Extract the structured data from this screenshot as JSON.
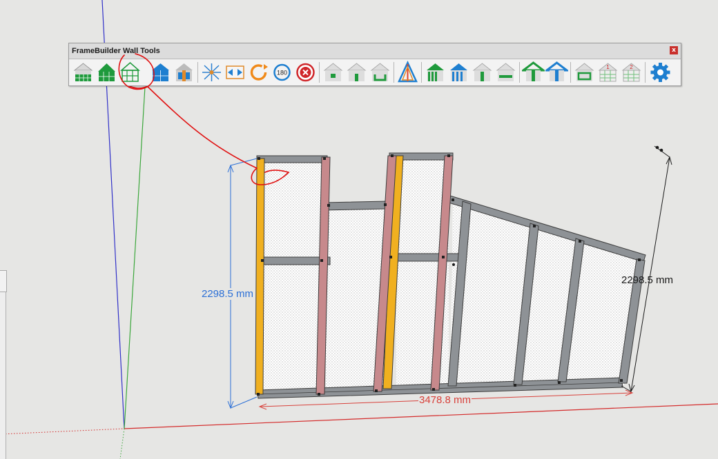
{
  "toolbar": {
    "title": "FrameBuilder Wall Tools",
    "close_label": "x",
    "buttons": [
      {
        "name": "wall-panel-icon"
      },
      {
        "name": "gable-wall-icon"
      },
      {
        "name": "framed-gable-icon"
      },
      {
        "name": "blue-wall-icon"
      },
      {
        "name": "blue-window-wall-icon"
      },
      {
        "name": "explode-icon"
      },
      {
        "name": "stretch-icon"
      },
      {
        "name": "rotate-icon"
      },
      {
        "name": "rotate-180-icon",
        "label": "180"
      },
      {
        "name": "delete-icon"
      },
      {
        "name": "opening-square-icon"
      },
      {
        "name": "opening-door-icon"
      },
      {
        "name": "opening-u-icon"
      },
      {
        "name": "triangle-icon"
      },
      {
        "name": "green-house-icon"
      },
      {
        "name": "blue-house-icon"
      },
      {
        "name": "stud-icon"
      },
      {
        "name": "header-icon"
      },
      {
        "name": "green-roof-icon"
      },
      {
        "name": "blue-roof-icon"
      },
      {
        "name": "window-frame-icon"
      },
      {
        "name": "grid-1-icon",
        "label": "1"
      },
      {
        "name": "grid-2-icon",
        "label": "2"
      },
      {
        "name": "settings-gear-icon"
      }
    ]
  },
  "dimensions": {
    "left_height": "2298.5 mm",
    "right_height": "2298.5 mm",
    "bottom_length": "3478.8 mm"
  },
  "colors": {
    "background": "#e6e6e4",
    "axis_red": "#d42a2a",
    "axis_green": "#3aa63a",
    "axis_blue": "#3030c8",
    "dimension_blue": "#2b6fd6",
    "dimension_red": "#d8403a",
    "stud_gray": "#8e9296",
    "stud_yellow": "#f0b020",
    "stud_pink": "#c7898c",
    "annotation_red": "#e01010"
  }
}
